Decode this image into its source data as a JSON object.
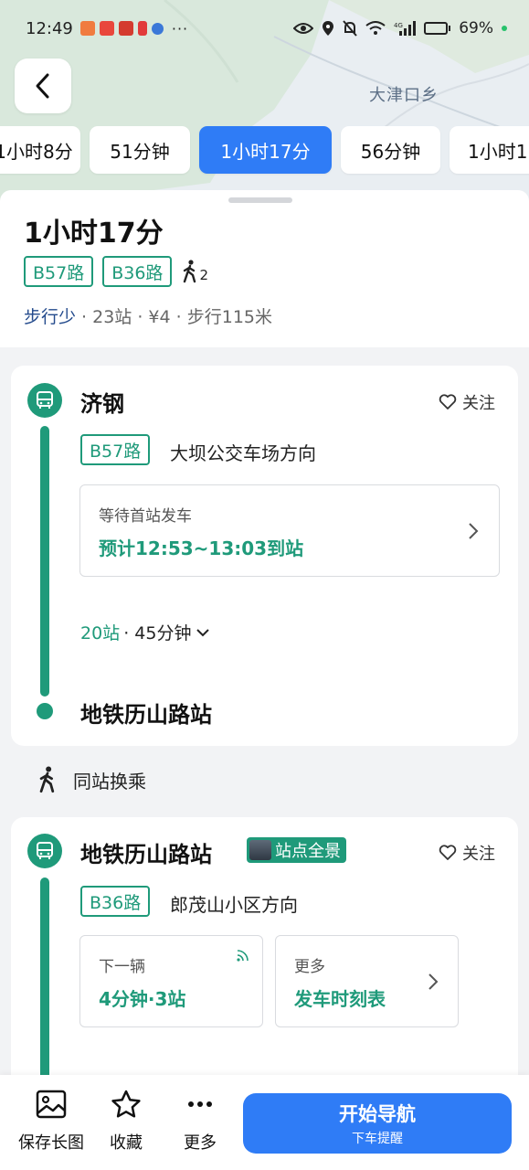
{
  "status_bar": {
    "time": "12:49",
    "dots": "···",
    "battery": "69%",
    "battery_level": 0.69
  },
  "map": {
    "label": "大津口乡"
  },
  "tabs": [
    {
      "label": "1小时8分",
      "active": false
    },
    {
      "label": "51分钟",
      "active": false
    },
    {
      "label": "1小时17分",
      "active": true
    },
    {
      "label": "56分钟",
      "active": false
    },
    {
      "label": "1小时1",
      "active": false
    }
  ],
  "summary": {
    "title": "1小时17分",
    "routes": [
      "B57路",
      "B36路"
    ],
    "walk_count": "2",
    "highlight": "步行少",
    "meta": " · 23站 · ¥4 · 步行115米"
  },
  "segment1": {
    "start_stop": "济钢",
    "follow": "关注",
    "line": "B57路",
    "direction": "大坝公交车场方向",
    "wait_label": "等待首站发车",
    "eta": "预计12:53~13:03到站",
    "stations": "20站",
    "duration": " · 45分钟",
    "end_stop": "地铁历山路站"
  },
  "transfer": {
    "label": "同站换乘"
  },
  "segment2": {
    "start_stop": "地铁历山路站",
    "panorama": "站点全景",
    "follow": "关注",
    "line": "B36路",
    "direction": "郎茂山小区方向",
    "next_label": "下一辆",
    "next_value": "4分钟·3站",
    "more_label": "更多",
    "more_value": "发车时刻表"
  },
  "bottom_bar": {
    "save_image": "保存长图",
    "favorite": "收藏",
    "more": "更多",
    "navigate": "开始导航",
    "navigate_sub": "下车提醒"
  },
  "colors": {
    "accent_blue": "#2f7cf6",
    "route_green": "#1f9a7a"
  }
}
